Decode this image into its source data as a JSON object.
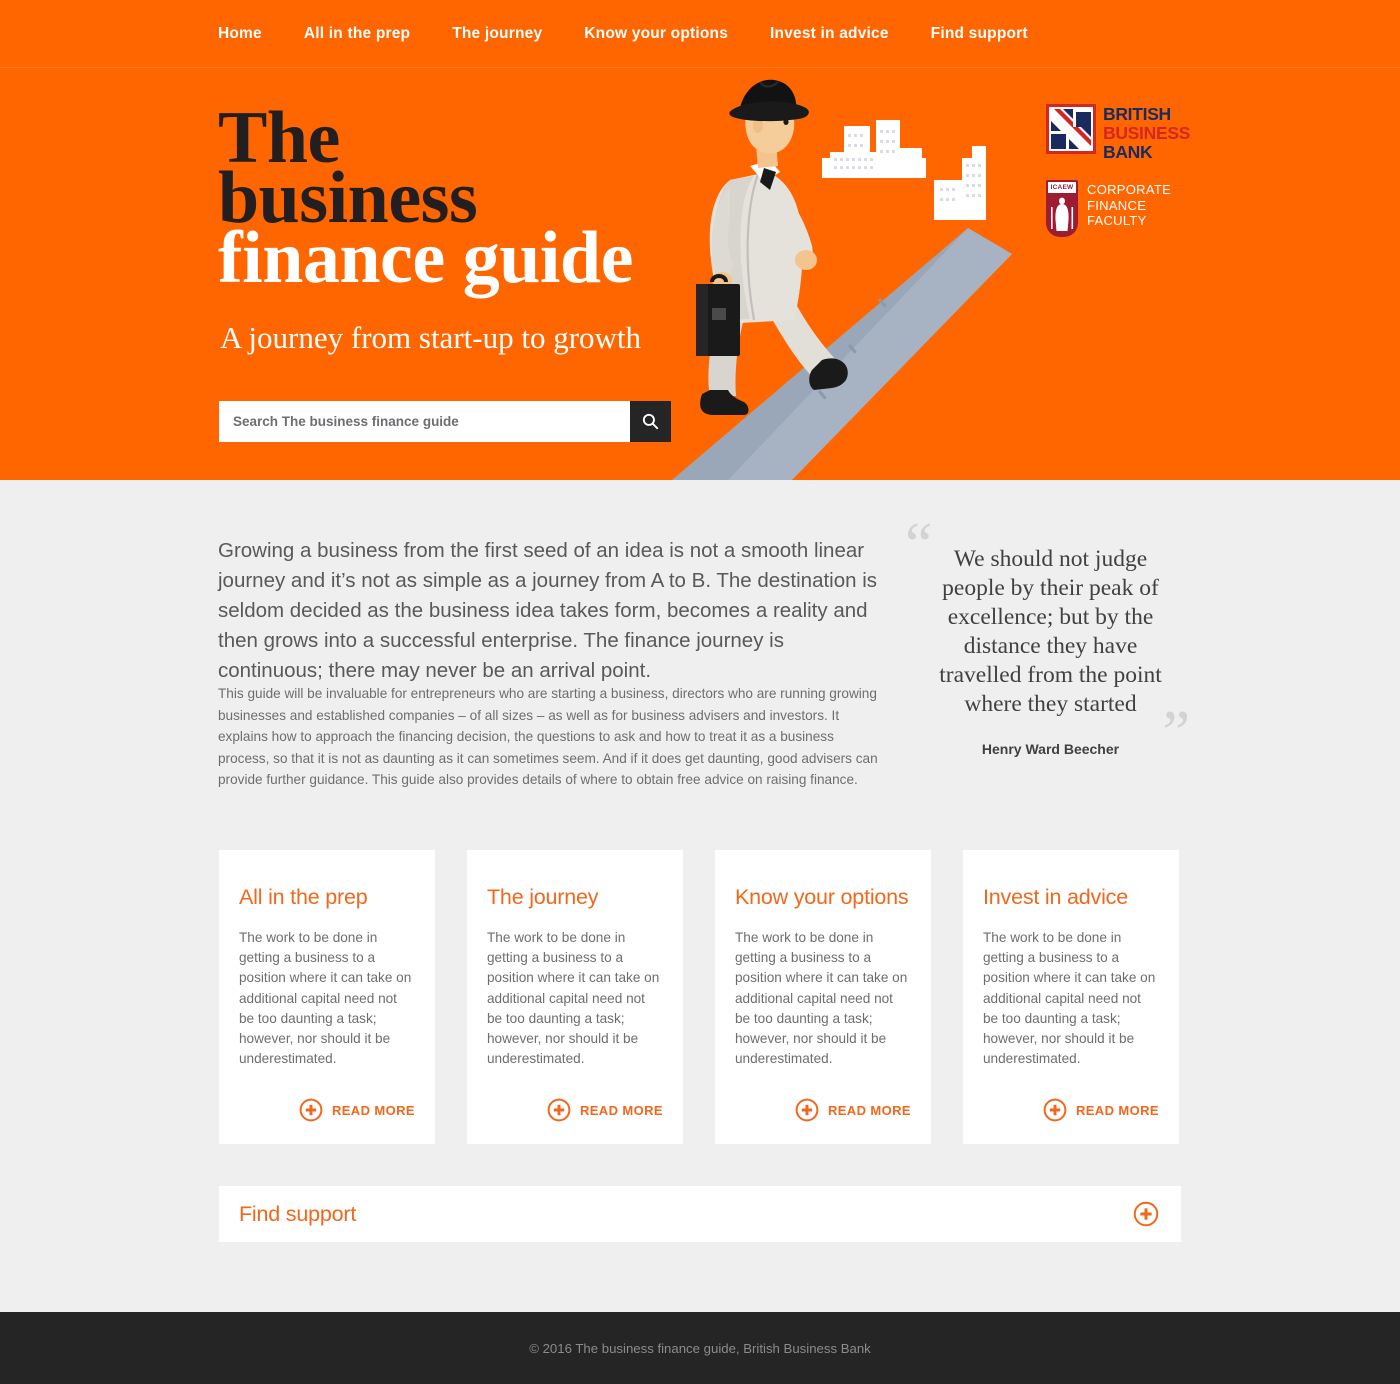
{
  "colors": {
    "orange": "#ff6600",
    "accent": "#f1681d",
    "page_bg": "#efefef",
    "dark": "#252525",
    "bbb_navy": "#1b2a5e",
    "bbb_red": "#d7261f",
    "icaew_red": "#9d1b33"
  },
  "nav": {
    "items": [
      {
        "label": "Home"
      },
      {
        "label": "All in the prep"
      },
      {
        "label": "The journey"
      },
      {
        "label": "Know your options"
      },
      {
        "label": "Invest in advice"
      },
      {
        "label": "Find support"
      }
    ]
  },
  "hero": {
    "title_line1": "The",
    "title_line2": "business",
    "title_line3": "finance guide",
    "subtitle": "A journey from start-up to growth",
    "search": {
      "placeholder": "Search The business finance guide",
      "value": "",
      "button_icon": "search-icon"
    },
    "illustration_alt": "businessman-walking-up-road-illustration"
  },
  "logos": {
    "bbb": {
      "line1": "BRITISH",
      "line2": "BUSINESS",
      "line3": "BANK",
      "mark": "union-jack-square-mark"
    },
    "icaew": {
      "tag": "ICAEW",
      "line1": "CORPORATE",
      "line2": "FINANCE",
      "line3": "FACULTY",
      "mark": "icaew-shield-mark"
    }
  },
  "main": {
    "lead": "Growing a business from the first seed of an idea is not a smooth linear journey and it’s not as simple as a journey from A to B. The destination is seldom decided as the business idea takes form, becomes a reality and then grows into a successful enterprise. The finance journey is continuous; there may never be an arrival point.",
    "body": "This guide will be invaluable for entrepreneurs who are starting a business, directors who are running growing businesses and established companies – of all sizes – as well as for business advisers and investors. It explains how to approach the financing decision, the questions to ask and how to treat it as a business process, so that it is not as daunting as it can sometimes seem. And if it does get daunting, good advisers can provide further guidance. This guide also provides details of where to obtain free advice on raising finance.",
    "quote": {
      "open_mark": "“",
      "close_mark": "”",
      "text": "We should not judge people by their peak of excellence; but by the distance they have travelled from the point where they started",
      "author": "Henry Ward Beecher"
    }
  },
  "cards": [
    {
      "title": "All in the prep",
      "body": "The work to be done in getting a business to a position where it can take on additional capital need not be too daunting a task; however, nor should it be underestimated.",
      "read_more": "READ MORE"
    },
    {
      "title": "The journey",
      "body": "The work to be done in getting a business to a position where it can take on additional capital need not be too daunting a task; however, nor should it be underestimated.",
      "read_more": "READ MORE"
    },
    {
      "title": "Know your options",
      "body": "The work to be done in getting a business to a position where it can take on additional capital need not be too daunting a task; however, nor should it be underestimated.",
      "read_more": "READ MORE"
    },
    {
      "title": "Invest in advice",
      "body": "The work to be done in getting a business to a position where it can take on additional capital need not be too daunting a task; however, nor should it be underestimated.",
      "read_more": "READ MORE"
    }
  ],
  "find_support": {
    "label": "Find support",
    "icon": "plus-circle-icon"
  },
  "footer": {
    "copyright": "© 2016 The business finance guide, British Business Bank"
  }
}
